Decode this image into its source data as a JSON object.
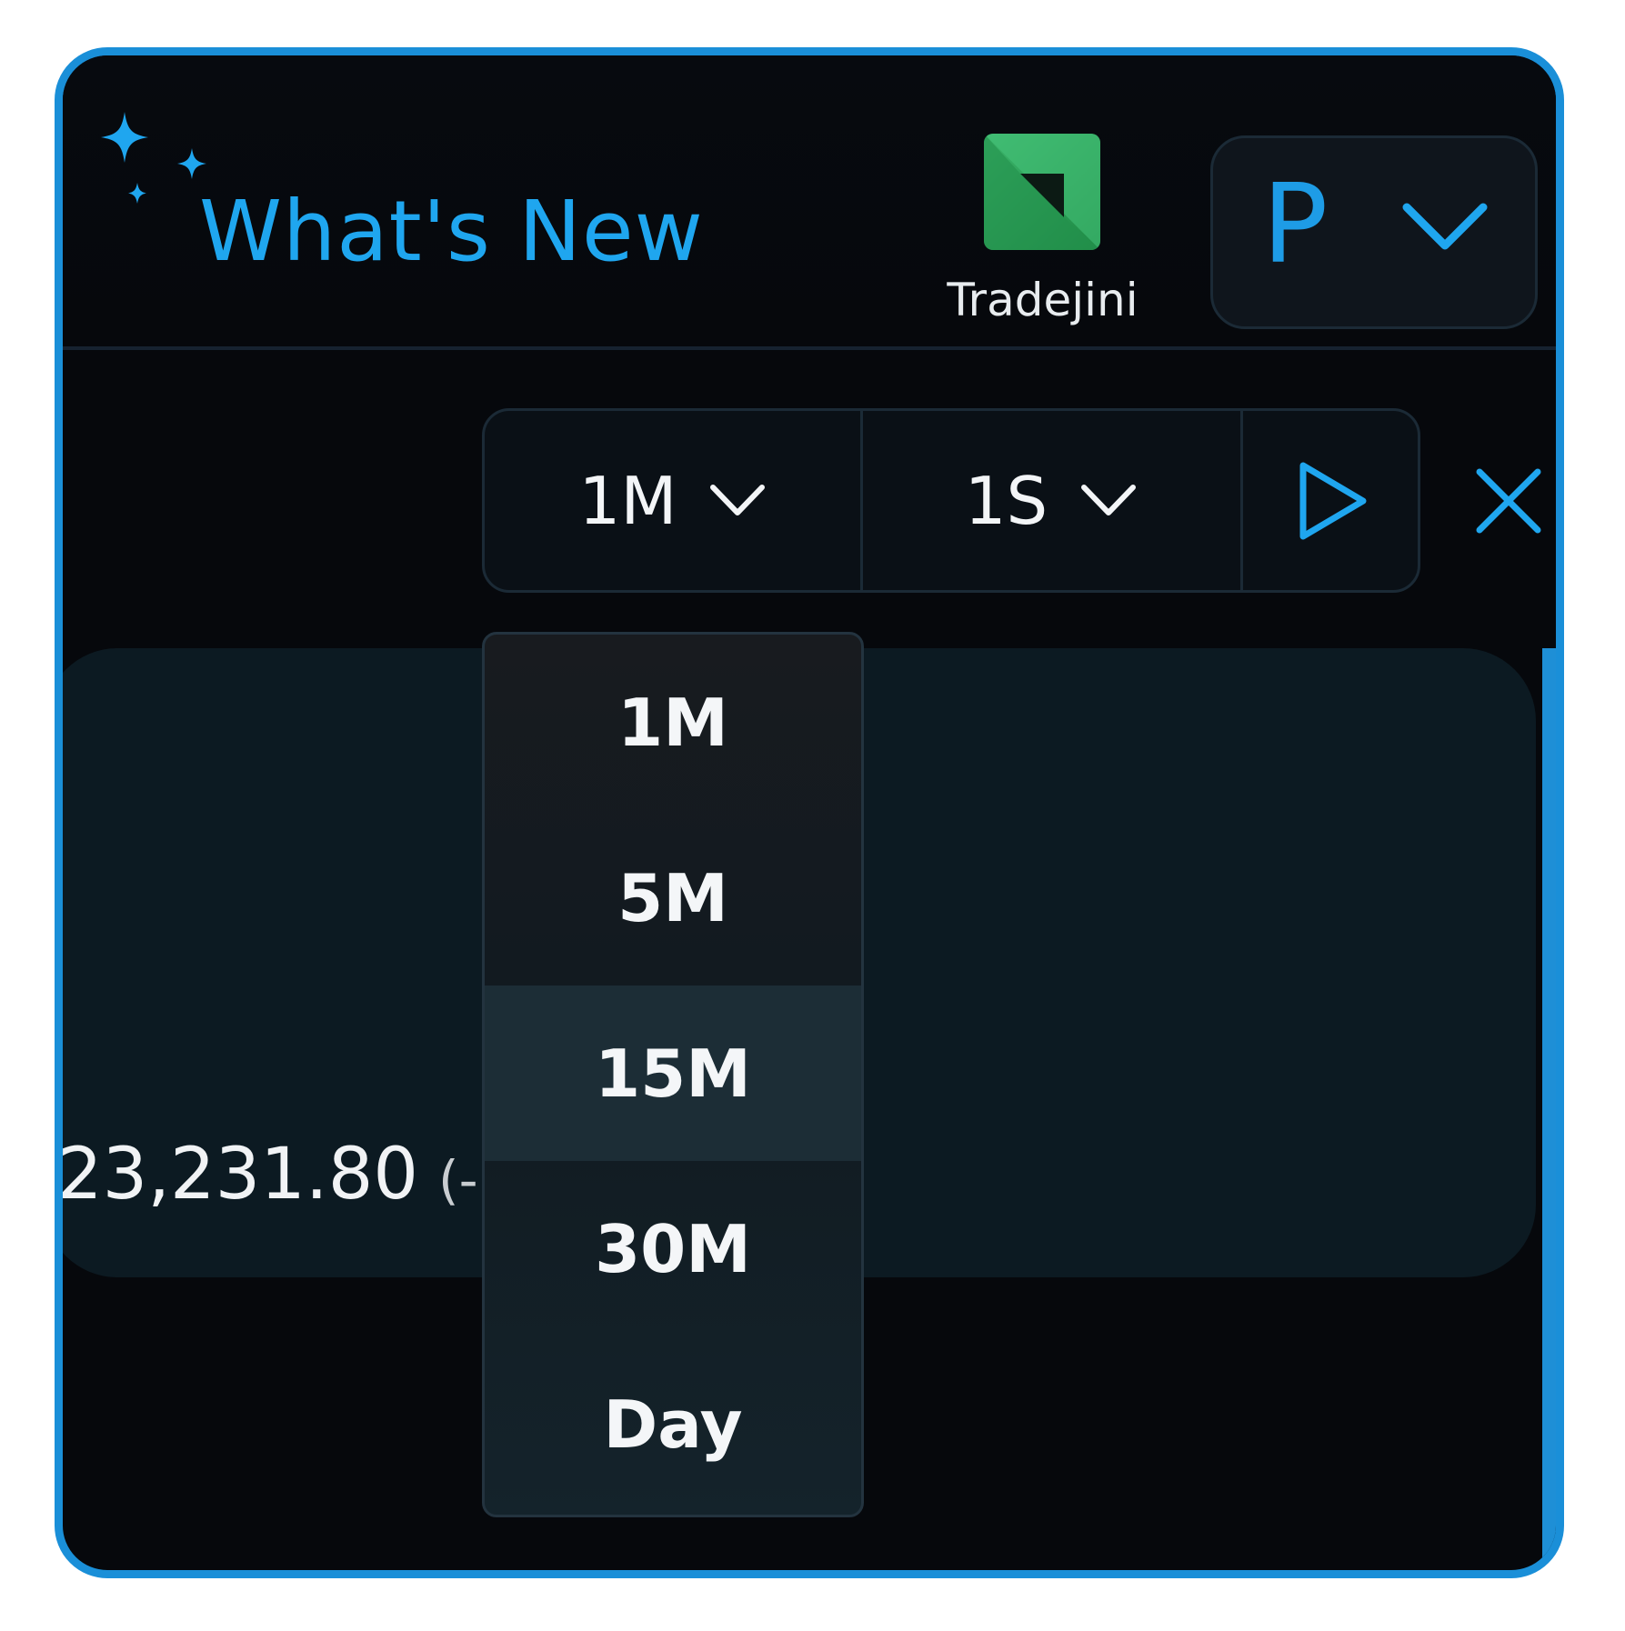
{
  "header": {
    "whats_new_label": "What's New",
    "broker_name": "Tradejini",
    "profile_initial": "P"
  },
  "toolbar": {
    "interval_value": "1M",
    "speed_value": "1S"
  },
  "interval_menu": {
    "options": [
      "1M",
      "5M",
      "15M",
      "30M",
      "Day"
    ],
    "highlighted": "15M"
  },
  "content": {
    "price": "23,231.80",
    "change_prefix": "(-"
  },
  "colors": {
    "accent": "#1fa6ef",
    "frame": "#1a8fd8",
    "background": "#06080c",
    "logo_green": "#2ea55a"
  },
  "icons": {
    "sparkle": "sparkle-icon",
    "chevron": "chevron-down-icon",
    "play": "play-icon",
    "close": "close-icon"
  }
}
